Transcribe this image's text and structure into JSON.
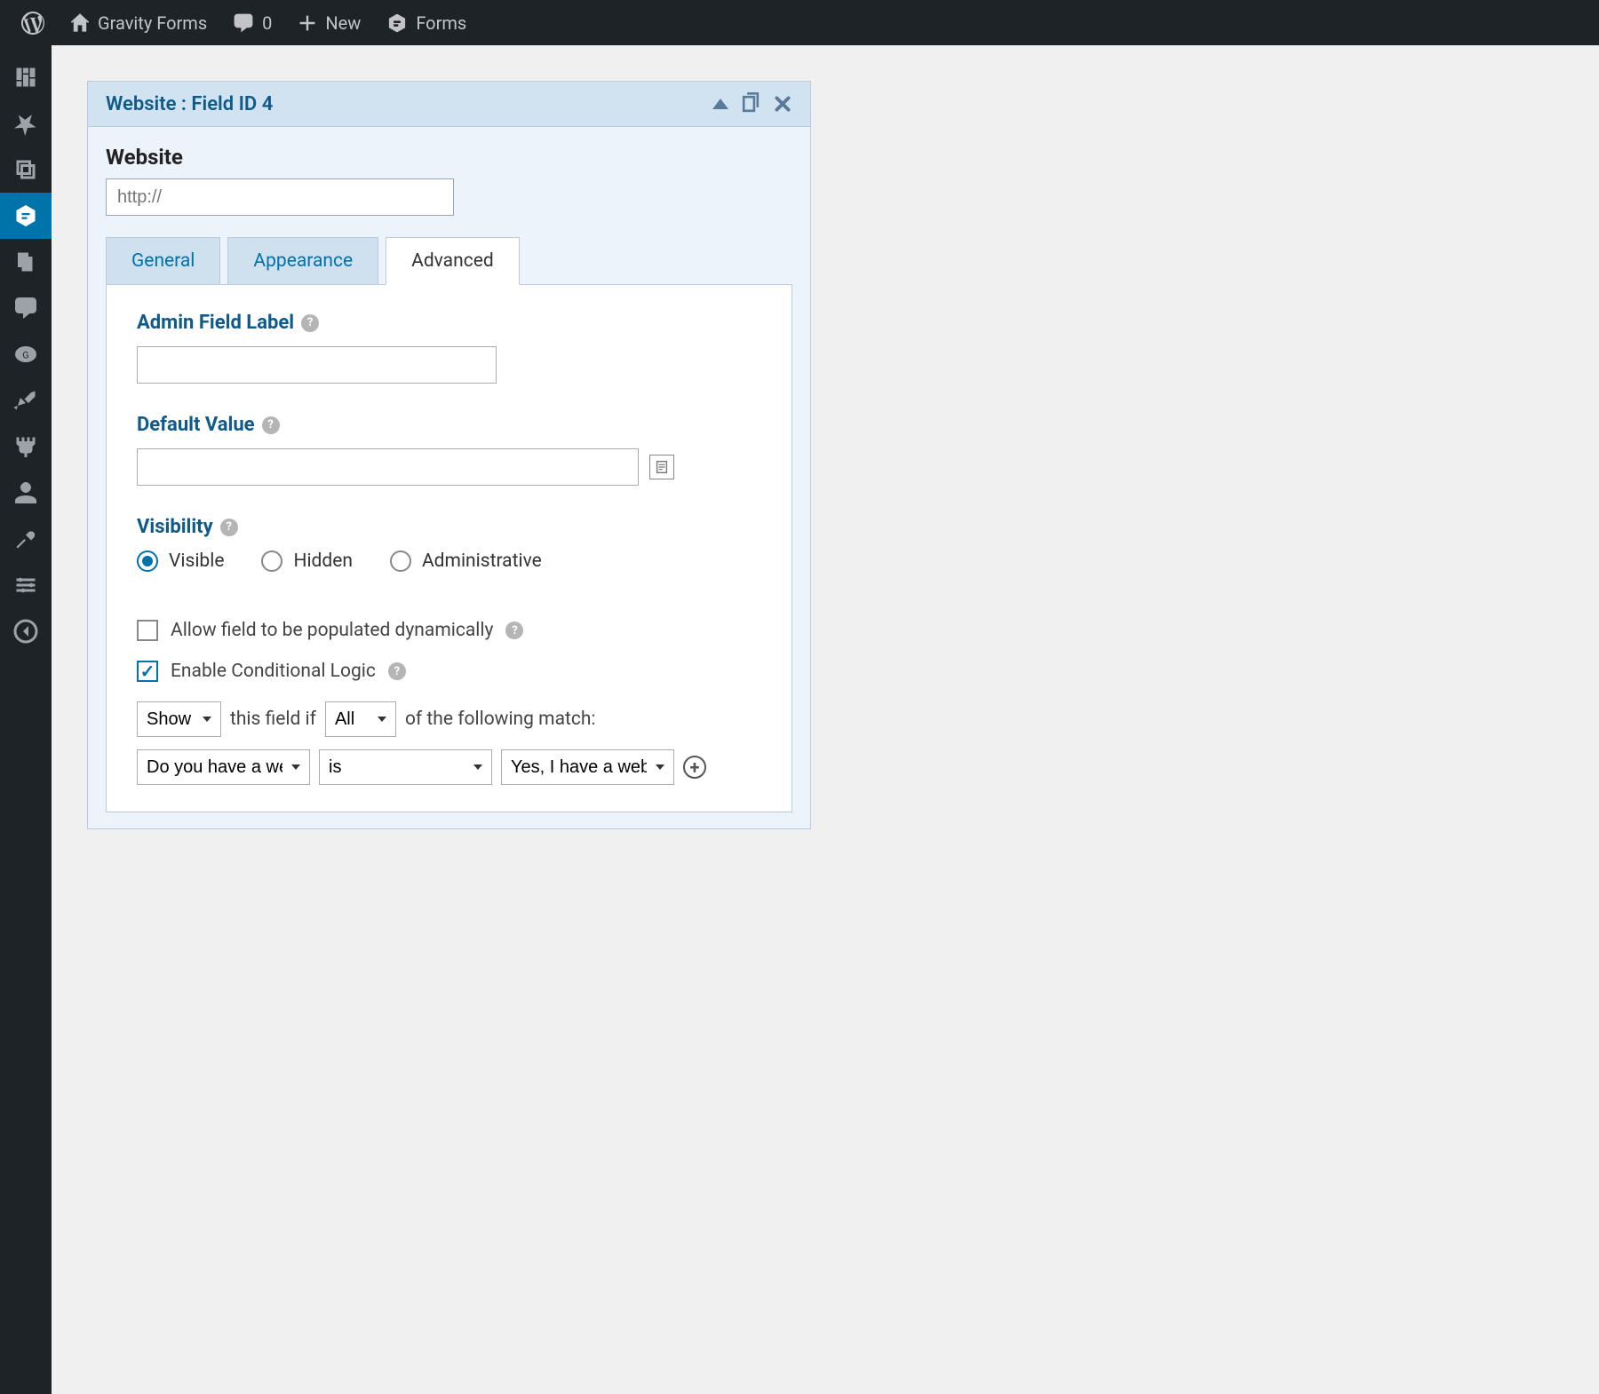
{
  "adminbar": {
    "site_name": "Gravity Forms",
    "comments_count": "0",
    "new_label": "New",
    "forms_label": "Forms"
  },
  "panel": {
    "header_title": "Website : Field ID 4",
    "preview_label": "Website",
    "url_placeholder": "http://"
  },
  "tabs": {
    "general": "General",
    "appearance": "Appearance",
    "advanced": "Advanced"
  },
  "advanced": {
    "admin_label_heading": "Admin Field Label",
    "admin_label_value": "",
    "default_value_heading": "Default Value",
    "default_value": "",
    "visibility_heading": "Visibility",
    "visibility_options": {
      "visible": "Visible",
      "hidden": "Hidden",
      "admin": "Administrative"
    },
    "allow_dynamic": "Allow field to be populated dynamically",
    "enable_conditional": "Enable Conditional Logic",
    "logic": {
      "action_select": "Show",
      "text1": "this field if",
      "match_select": "All",
      "text2": "of the following match:",
      "rule_field": "Do you have a website?",
      "rule_op": "is",
      "rule_value": "Yes, I have a website"
    }
  }
}
